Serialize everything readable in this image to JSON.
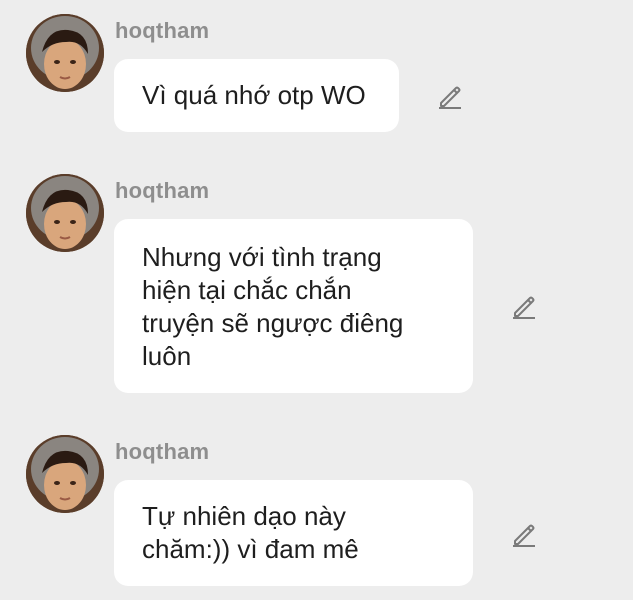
{
  "colors": {
    "background": "#ededed",
    "bubble": "#ffffff",
    "username": "#8e8e8e",
    "text": "#1e1e1e",
    "icon": "#7a7a7a"
  },
  "messages": [
    {
      "username": "hoqtham",
      "text": "Vì quá nhớ otp WO",
      "avatar_icon": "user-avatar",
      "action_icon": "pencil-edit-icon"
    },
    {
      "username": "hoqtham",
      "text": "Nhưng với tình trạng hiện tại chắc chắn truyện sẽ ngược điêng luôn",
      "lines": [
        "Nhưng với tình trạng",
        "hiện tại chắc chắn",
        "truyện sẽ ngược điêng",
        "luôn"
      ],
      "avatar_icon": "user-avatar",
      "action_icon": "pencil-edit-icon"
    },
    {
      "username": "hoqtham",
      "text": "Tự nhiên dạo này chăm:)) vì đam mê",
      "lines": [
        "Tự nhiên dạo này",
        "chăm:)) vì đam mê"
      ],
      "avatar_icon": "user-avatar",
      "action_icon": "pencil-edit-icon"
    }
  ]
}
